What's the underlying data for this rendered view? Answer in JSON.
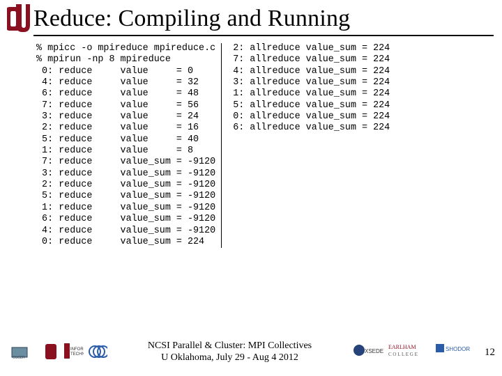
{
  "title": "Reduce: Compiling and Running",
  "cmd_compile": "% mpicc -o mpireduce mpireduce.c",
  "cmd_run": "% mpirun -np 8 mpireduce",
  "left_lines": [
    " 0: reduce     value     = 0",
    " 4: reduce     value     = 32",
    " 6: reduce     value     = 48",
    " 7: reduce     value     = 56",
    " 3: reduce     value     = 24",
    " 2: reduce     value     = 16",
    " 5: reduce     value     = 40",
    " 1: reduce     value     = 8",
    " 7: reduce     value_sum = -9120",
    " 3: reduce     value_sum = -9120",
    " 2: reduce     value_sum = -9120",
    " 5: reduce     value_sum = -9120",
    " 1: reduce     value_sum = -9120",
    " 6: reduce     value_sum = -9120",
    " 4: reduce     value_sum = -9120",
    " 0: reduce     value_sum = 224"
  ],
  "right_lines": [
    " 2: allreduce value_sum = 224",
    " 7: allreduce value_sum = 224",
    " 4: allreduce value_sum = 224",
    " 3: allreduce value_sum = 224",
    " 1: allreduce value_sum = 224",
    " 5: allreduce value_sum = 224",
    " 0: allreduce value_sum = 224",
    " 6: allreduce value_sum = 224"
  ],
  "footer_line1": "NCSI Parallel & Cluster: MPI Collectives",
  "footer_line2": "U Oklahoma, July 29 - Aug 4 2012",
  "page_number": "12"
}
